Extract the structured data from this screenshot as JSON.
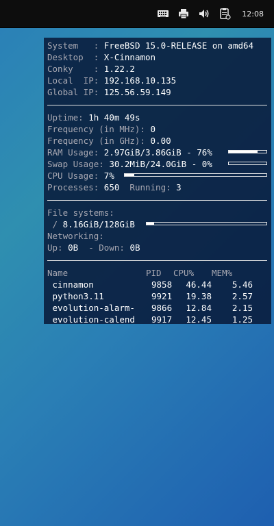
{
  "panel": {
    "clock": "12:08",
    "tray_icons": [
      "keyboard-icon",
      "printer-icon",
      "volume-icon",
      "clipboard-icon"
    ]
  },
  "conky": {
    "system": {
      "system_label": "System   : ",
      "system_value": "FreeBSD 15.0-RELEASE on amd64",
      "desktop_label": "Desktop  : ",
      "desktop_value": "X-Cinnamon",
      "conky_label": "Conky    : ",
      "conky_value": "1.22.2",
      "local_ip_label": "Local  IP: ",
      "local_ip_value": "192.168.10.135",
      "global_ip_label": "Global IP: ",
      "global_ip_value": "125.56.59.149"
    },
    "stats": {
      "uptime_label": "Uptime: ",
      "uptime_value": "1h 40m 49s",
      "freq_mhz_label": "Frequency (in MHz): ",
      "freq_mhz_value": "0",
      "freq_ghz_label": "Frequency (in GHz): ",
      "freq_ghz_value": "0.00",
      "ram_label": "RAM Usage: ",
      "ram_value": "2.97GiB/3.86GiB - 76%",
      "ram_percent": 76,
      "swap_label": "Swap Usage: ",
      "swap_value": "30.2MiB/24.0GiB - 0%",
      "swap_percent": 0,
      "cpu_label": "CPU Usage: ",
      "cpu_value": "7%",
      "cpu_percent": 7,
      "processes_label": "Processes: ",
      "processes_value": "650",
      "running_label": "  Running: ",
      "running_value": "3"
    },
    "storage": {
      "fs_label": "File systems:",
      "root_label": " / ",
      "root_value": "8.16GiB/128GiB",
      "root_percent": 6,
      "net_label": "Networking:",
      "up_label": "Up: ",
      "up_value": "0B",
      "down_label": "  - Down: ",
      "down_value": "0B"
    },
    "processes": {
      "headers": {
        "name": "Name",
        "pid": "PID",
        "cpu": "CPU%",
        "mem": "MEM%"
      },
      "rows": [
        {
          "name": " cinnamon",
          "pid": "9858",
          "cpu": "46.44",
          "mem": "5.46"
        },
        {
          "name": " python3.11",
          "pid": "9921",
          "cpu": "19.38",
          "mem": "2.57"
        },
        {
          "name": " evolution-alarm-",
          "pid": "9866",
          "cpu": "12.84",
          "mem": "2.15"
        },
        {
          "name": " evolution-calend",
          "pid": "9917",
          "cpu": "12.45",
          "mem": "1.25"
        }
      ]
    }
  }
}
